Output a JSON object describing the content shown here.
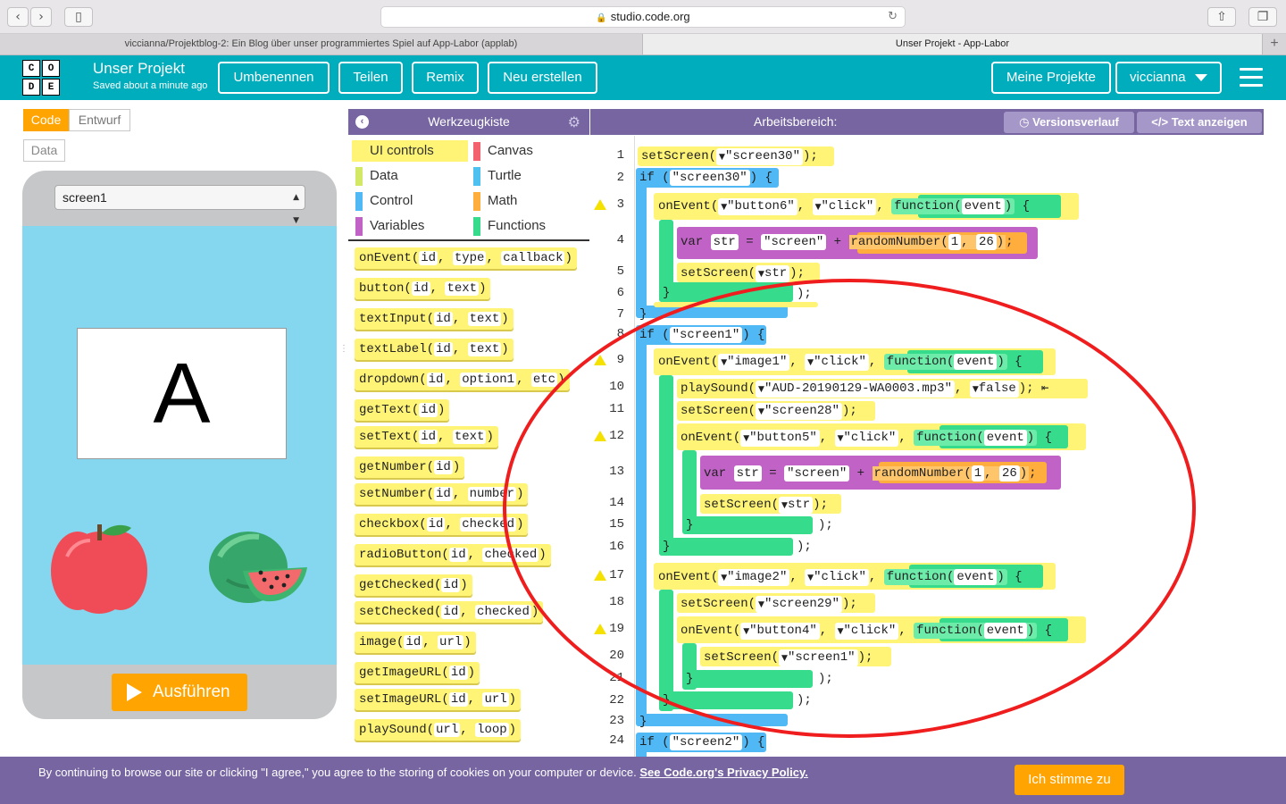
{
  "browser": {
    "url": "studio.code.org",
    "tabs": [
      "viccianna/Projektblog-2: Ein Blog über unser programmiertes Spiel auf App-Labor (applab)",
      "Unser Projekt - App-Labor"
    ]
  },
  "header": {
    "project_title": "Unser Projekt",
    "saved_status": "Saved about a minute ago",
    "buttons": [
      "Umbenennen",
      "Teilen",
      "Remix",
      "Neu erstellen"
    ],
    "my_projects": "Meine Projekte",
    "user": "viccianna",
    "logo_letters": [
      "C",
      "O",
      "D",
      "E"
    ]
  },
  "left_panel": {
    "mode_code": "Code",
    "mode_design": "Entwurf",
    "data_button": "Data",
    "screen_selector": "screen1",
    "label_text": "A",
    "run_button": "Ausführen"
  },
  "toolbox": {
    "title": "Werkzeugkiste",
    "categories": [
      {
        "name": "UI controls",
        "color": "#fff476"
      },
      {
        "name": "Canvas",
        "color": "#f46270"
      },
      {
        "name": "Data",
        "color": "#d3e965"
      },
      {
        "name": "Turtle",
        "color": "#4fc1f0"
      },
      {
        "name": "Control",
        "color": "#4fb8f5"
      },
      {
        "name": "Math",
        "color": "#ffae3d"
      },
      {
        "name": "Variables",
        "color": "#c162c6"
      },
      {
        "name": "Functions",
        "color": "#37db8c"
      }
    ],
    "blocks": [
      {
        "fn": "onEvent",
        "args": [
          "id",
          "type",
          "callback"
        ]
      },
      {
        "fn": "button",
        "args": [
          "id",
          "text"
        ]
      },
      {
        "fn": "textInput",
        "args": [
          "id",
          "text"
        ]
      },
      {
        "fn": "textLabel",
        "args": [
          "id",
          "text"
        ]
      },
      {
        "fn": "dropdown",
        "args": [
          "id",
          "option1",
          "etc"
        ]
      },
      {
        "fn": "getText",
        "args": [
          "id"
        ]
      },
      {
        "fn": "setText",
        "args": [
          "id",
          "text"
        ]
      },
      {
        "fn": "getNumber",
        "args": [
          "id"
        ]
      },
      {
        "fn": "setNumber",
        "args": [
          "id",
          "number"
        ]
      },
      {
        "fn": "checkbox",
        "args": [
          "id",
          "checked"
        ]
      },
      {
        "fn": "radioButton",
        "args": [
          "id",
          "checked"
        ]
      },
      {
        "fn": "getChecked",
        "args": [
          "id"
        ]
      },
      {
        "fn": "setChecked",
        "args": [
          "id",
          "checked"
        ]
      },
      {
        "fn": "image",
        "args": [
          "id",
          "url"
        ]
      },
      {
        "fn": "getImageURL",
        "args": [
          "id"
        ]
      },
      {
        "fn": "setImageURL",
        "args": [
          "id",
          "url"
        ]
      },
      {
        "fn": "playSound",
        "args": [
          "url",
          "loop"
        ]
      }
    ]
  },
  "workspace": {
    "title": "Arbeitsbereich:",
    "version_history": "Versionsverlauf",
    "show_text": "Text anzeigen",
    "line_numbers": [
      "1",
      "2",
      "3",
      "4",
      "5",
      "6",
      "7",
      "8",
      "9",
      "10",
      "11",
      "12",
      "13",
      "14",
      "15",
      "16",
      "17",
      "18",
      "19",
      "20",
      "21",
      "22",
      "23",
      "24"
    ],
    "warning_lines": [
      "3",
      "9",
      "12",
      "17",
      "19"
    ],
    "code": {
      "setScreen": "setScreen",
      "if": "if",
      "onEvent": "onEvent",
      "function": "function",
      "event": "event",
      "var": "var",
      "str": "str",
      "randomNumber": "randomNumber",
      "playSound": "playSound",
      "screen30": "\"screen30\"",
      "screen1": "\"screen1\"",
      "screen2": "\"screen2\"",
      "screen28": "\"screen28\"",
      "screen29": "\"screen29\"",
      "screen": "\"screen\"",
      "button6": "\"button6\"",
      "button5": "\"button5\"",
      "button4": "\"button4\"",
      "image1": "\"image1\"",
      "image2": "\"image2\"",
      "click": "\"click\"",
      "sound_file": "\"AUD-20190129-WA0003.mp3\"",
      "false": "false",
      "num1": "1",
      "num26": "26"
    }
  },
  "cookie_bar": {
    "text": "By continuing to browse our site or clicking \"I agree,\" you agree to the storing of cookies on your computer or device.",
    "link": "See Code.org's Privacy Policy.",
    "agree": "Ich stimme zu"
  }
}
